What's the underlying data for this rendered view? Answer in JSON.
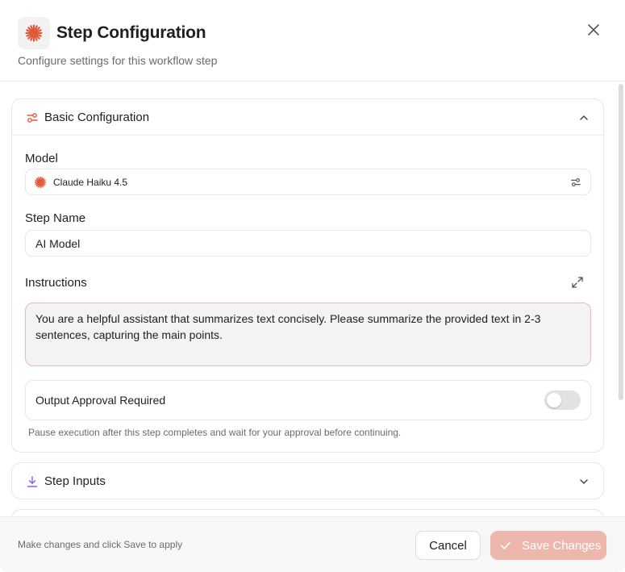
{
  "header": {
    "title": "Step Configuration",
    "subtitle": "Configure settings for this workflow step",
    "close_icon": "close-icon"
  },
  "colors": {
    "accent": "#e05a3a",
    "inputs_icon": "#8b5cf6",
    "save_disabled": "#eeb7ad",
    "instructions_border": "#e8b9bf"
  },
  "basic": {
    "title": "Basic Configuration",
    "model_label": "Model",
    "model_value": "Claude Haiku 4.5",
    "step_name_label": "Step Name",
    "step_name_value": "AI Model",
    "instructions_label": "Instructions",
    "instructions_value": "You are a helpful assistant that summarizes text concisely. Please summarize the provided text in 2-3 sentences, capturing the main points.",
    "approval_label": "Output Approval Required",
    "approval_enabled": false,
    "approval_help": "Pause execution after this step completes and wait for your approval before continuing."
  },
  "inputs": {
    "title": "Step Inputs"
  },
  "footer": {
    "hint": "Make changes and click Save to apply",
    "cancel_label": "Cancel",
    "save_label": "Save Changes"
  }
}
